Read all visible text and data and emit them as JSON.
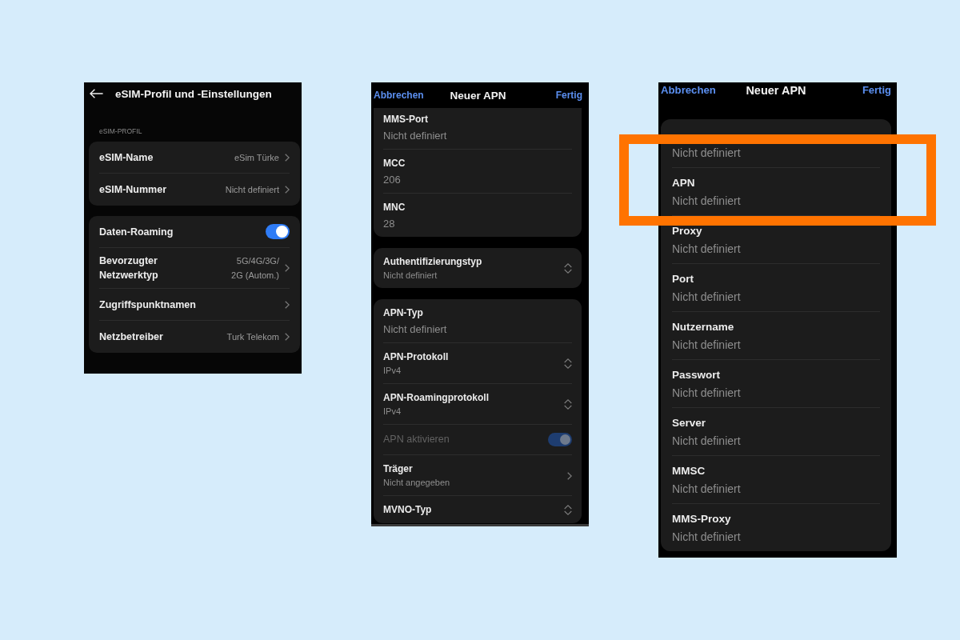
{
  "screens": [
    {
      "kind": "settings",
      "title": "eSIM-Profil und -Einstellungen",
      "groups": [
        {
          "title": "eSIM-PROFIL",
          "rows": [
            {
              "kind": "nav",
              "label": "eSIM-Name",
              "value": "eSim Türke"
            },
            {
              "kind": "nav",
              "label": "eSIM-Nummer",
              "value": "Nicht definiert"
            }
          ]
        },
        {
          "rows": [
            {
              "kind": "toggle",
              "label": "Daten-Roaming",
              "on": true,
              "disabled": false
            },
            {
              "kind": "nav",
              "label": "Bevorzugter Netzwerktyp",
              "value": "5G/4G/3G/\n2G (Autom.)"
            },
            {
              "kind": "nav",
              "label": "Zugriffspunktnamen"
            },
            {
              "kind": "nav",
              "label": "Netzbetreiber",
              "value": "Turk Telekom"
            }
          ]
        }
      ]
    },
    {
      "kind": "apn-editor",
      "cancel": "Abbrechen",
      "title": "Neuer APN",
      "done": "Fertig",
      "scrolled": true,
      "groups": [
        {
          "rows": [
            {
              "kind": "field",
              "label": "MMS-Port",
              "value": "Nicht definiert"
            },
            {
              "kind": "field",
              "label": "MCC",
              "value": "206"
            },
            {
              "kind": "field",
              "label": "MNC",
              "value": "28"
            }
          ]
        },
        {
          "rows": [
            {
              "kind": "select",
              "label": "Authentifizierungstyp",
              "value": "Nicht definiert"
            }
          ]
        },
        {
          "rows": [
            {
              "kind": "field",
              "label": "APN-Typ",
              "value": "Nicht definiert"
            },
            {
              "kind": "select",
              "label": "APN-Protokoll",
              "value": "IPv4"
            },
            {
              "kind": "select",
              "label": "APN-Roamingprotokoll",
              "value": "IPv4"
            },
            {
              "kind": "toggle",
              "label": "APN aktivieren",
              "on": true,
              "disabled": true
            },
            {
              "kind": "nav",
              "label": "Träger",
              "value": "Nicht angegeben"
            },
            {
              "kind": "select",
              "label": "MVNO-Typ"
            }
          ]
        }
      ]
    },
    {
      "kind": "apn-editor",
      "cancel": "Abbrechen",
      "title": "Neuer APN",
      "done": "Fertig",
      "scrolled": false,
      "groups": [
        {
          "rows": [
            {
              "kind": "field",
              "value": "Nicht definiert",
              "highlighted": true
            },
            {
              "kind": "field",
              "label": "APN",
              "value": "Nicht definiert",
              "highlighted": true
            },
            {
              "kind": "field",
              "label": "Proxy",
              "value": "Nicht definiert",
              "highlighted": false
            },
            {
              "kind": "field",
              "label": "Port",
              "value": "Nicht definiert",
              "highlighted": false
            },
            {
              "kind": "field",
              "label": "Nutzername",
              "value": "Nicht definiert",
              "highlighted": false
            },
            {
              "kind": "field",
              "label": "Passwort",
              "value": "Nicht definiert",
              "highlighted": false
            },
            {
              "kind": "field",
              "label": "Server",
              "value": "Nicht definiert",
              "highlighted": false
            },
            {
              "kind": "field",
              "label": "MMSC",
              "value": "Nicht definiert",
              "highlighted": false
            },
            {
              "kind": "field",
              "label": "MMS-Proxy",
              "value": "Nicht definiert",
              "highlighted": false
            }
          ]
        }
      ]
    }
  ]
}
